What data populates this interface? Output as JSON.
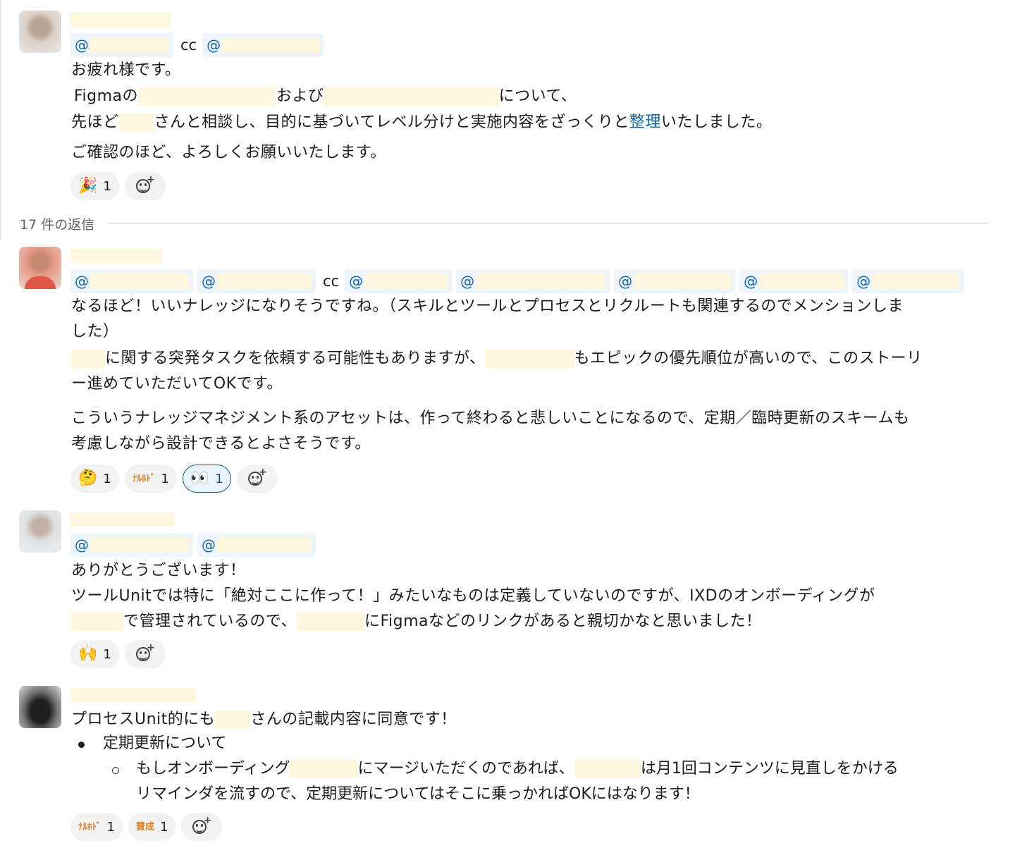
{
  "message1": {
    "cc_label": "cc",
    "lines": [
      "お疲れ様です。",
      "Figmaの",
      "および",
      "について、",
      "先ほど",
      "さんと相談し、目的に基づいてレベル分けと実施内容をざっくりと",
      "整理",
      "いたしました。",
      "ご確認のほど、よろしくお願いいたします。"
    ],
    "reactions": [
      {
        "emoji": "🎉",
        "count": "1",
        "active": false
      }
    ]
  },
  "thread": {
    "replies_label": "17 件の返信"
  },
  "message2": {
    "cc_label": "cc",
    "lines": [
      "なるほど！いいナレッジになりそうですね。（スキルとツールとプロセスとリクルートも関連するのでメンションしま",
      "した）",
      "に関する突発タスクを依頼する可能性もありますが、",
      "もエピックの優先順位が高いので、このストーリ",
      "ー進めていただいてOKです。",
      "こういうナレッジマネジメント系のアセットは、作って終わると悲しいことになるので、定期／臨時更新のスキームも",
      "考慮しながら設計できるとよさそうです。"
    ],
    "reactions": [
      {
        "emoji": "🤔",
        "count": "1",
        "active": false
      },
      {
        "emoji": "ﾅﾙﾎﾄﾞ",
        "count": "1",
        "active": false
      },
      {
        "emoji": "👀",
        "count": "1",
        "active": true
      }
    ]
  },
  "message3": {
    "lines": [
      "ありがとうございます！",
      "ツールUnitでは特に「絶対ここに作って！」みたいなものは定義していないのですが、IXDのオンボーディングが",
      "で管理されているので、",
      "にFigmaなどのリンクがあると親切かなと思いました！"
    ],
    "reactions": [
      {
        "emoji": "🙌",
        "count": "1",
        "active": false
      }
    ]
  },
  "message4": {
    "lines": [
      "プロセスUnit的にも",
      "さんの記載内容に同意です！"
    ],
    "bullet1": "定期更新について",
    "sub_bullet": {
      "part1": "もしオンボーディング",
      "part2": "にマージいただくのであれば、",
      "part3": "は月1回コンテンツに見直しをかける",
      "line2": "リマインダを流すので、定期更新についてはそこに乗っかればOKにはなります！"
    },
    "reactions": [
      {
        "emoji": "ﾅﾙﾎﾄﾞ",
        "count": "1",
        "active": false
      },
      {
        "emoji": "賛成",
        "count": "1",
        "active": false
      }
    ]
  },
  "icons": {
    "add_reaction": "add-reaction-icon"
  }
}
